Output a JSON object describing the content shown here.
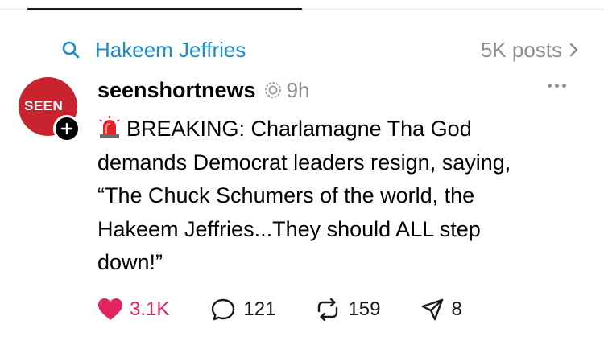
{
  "topic": {
    "name": "Hakeem Jeffries",
    "posts_count": "5K posts"
  },
  "post": {
    "avatar_text": "SEEN",
    "username": "seenshortnews",
    "timestamp": "9h",
    "text_lines": [
      "BREAKING: Charlamagne Tha God",
      "demands Democrat leaders resign, saying,",
      "“The Chuck Schumers of the world, the",
      "Hakeem Jeffries...They should ALL step",
      "down!”"
    ],
    "actions": {
      "likes": "3.1K",
      "replies": "121",
      "reposts": "159",
      "shares": "8"
    }
  },
  "colors": {
    "link": "#1f8ac9",
    "like": "#e0245e",
    "avatar": "#c8232f",
    "muted": "#8e8e8e"
  },
  "icons": [
    "search-icon",
    "chevron-right-icon",
    "verified-icon",
    "more-icon",
    "siren-emoji-icon",
    "heart-icon",
    "reply-icon",
    "repost-icon",
    "share-icon",
    "plus-icon"
  ]
}
